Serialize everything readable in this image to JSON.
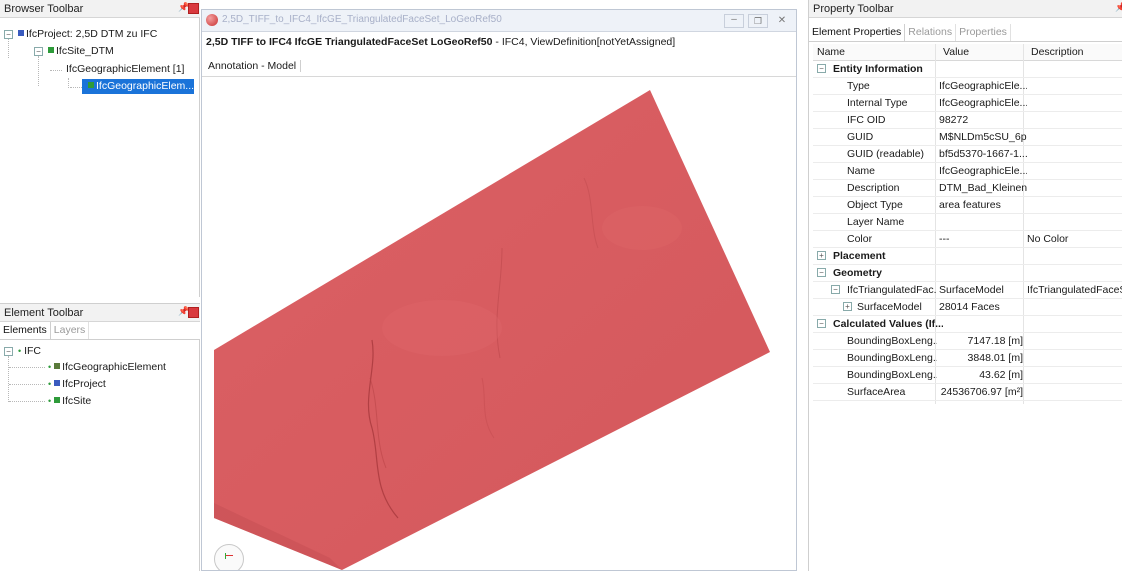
{
  "browser": {
    "title": "Browser Toolbar",
    "items": [
      {
        "label": "IfcProject: 2,5D DTM zu IFC"
      },
      {
        "label": "IfcSite_DTM"
      },
      {
        "label": "IfcGeographicElement [1]"
      },
      {
        "label": "IfcGeographicElem..."
      }
    ]
  },
  "element": {
    "title": "Element Toolbar",
    "tabs": [
      "Elements",
      "Layers"
    ],
    "root": "IFC",
    "items": [
      "IfcGeographicElement",
      "IfcProject",
      "IfcSite"
    ]
  },
  "viewer": {
    "window_title": "2,5D_TIFF_to_IFC4_IfcGE_TriangulatedFaceSet_LoGeoRef50",
    "heading_bold": "2,5D TIFF to IFC4 IfcGE TriangulatedFaceSet LoGeoRef50",
    "heading_rest": " - IFC4, ViewDefinition[notYetAssigned]",
    "tab": "Annotation - Model",
    "surface_color": "#d95a5e"
  },
  "property": {
    "title": "Property Toolbar",
    "tabs": [
      "Element Properties",
      "Relations",
      "Properties"
    ],
    "columns": [
      "Name",
      "Value",
      "Description"
    ],
    "rows": [
      {
        "group": true,
        "name": "Entity Information",
        "value": "",
        "desc": ""
      },
      {
        "name": "Type",
        "value": "IfcGeographicEle...",
        "desc": ""
      },
      {
        "name": "Internal Type",
        "value": "IfcGeographicEle...",
        "desc": ""
      },
      {
        "name": "IFC OID",
        "value": "98272",
        "desc": ""
      },
      {
        "name": "GUID",
        "value": "M$NLDm5cSU_6p...",
        "desc": ""
      },
      {
        "name": "GUID (readable)",
        "value": "bf5d5370-1667-1...",
        "desc": ""
      },
      {
        "name": "Name",
        "value": "IfcGeographicEle...",
        "desc": ""
      },
      {
        "name": "Description",
        "value": "DTM_Bad_Kleinen",
        "desc": ""
      },
      {
        "name": "Object Type",
        "value": "area features",
        "desc": ""
      },
      {
        "name": "Layer Name",
        "value": "",
        "desc": ""
      },
      {
        "name": "Color",
        "value": "---",
        "desc": "No Color"
      },
      {
        "group": true,
        "name": "Placement",
        "value": "",
        "desc": ""
      },
      {
        "group": true,
        "name": "Geometry",
        "value": "",
        "desc": ""
      },
      {
        "name": "IfcTriangulatedFac...",
        "value": "SurfaceModel",
        "desc": "IfcTriangulatedFaceSet"
      },
      {
        "name": "SurfaceModel",
        "value": "28014 Faces",
        "desc": ""
      },
      {
        "group": true,
        "name": "Calculated Values (If...",
        "value": "",
        "desc": ""
      },
      {
        "name": "BoundingBoxLeng...",
        "value": "7147.18 [m]",
        "desc": ""
      },
      {
        "name": "BoundingBoxLeng...",
        "value": "3848.01 [m]",
        "desc": ""
      },
      {
        "name": "BoundingBoxLeng...",
        "value": "43.62 [m]",
        "desc": ""
      },
      {
        "name": "SurfaceArea",
        "value": "24536706.97 [m²]",
        "desc": ""
      }
    ]
  }
}
